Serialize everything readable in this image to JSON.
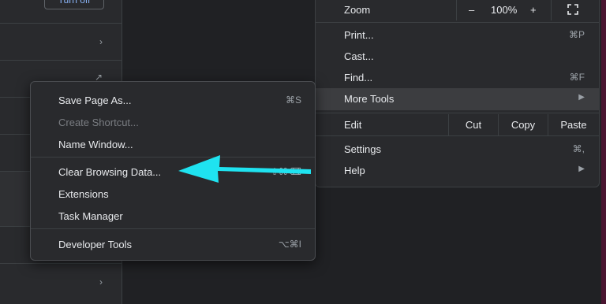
{
  "background": {
    "turn_off_label": "Turn off"
  },
  "main_menu": {
    "zoom": {
      "label": "Zoom",
      "minus": "–",
      "value": "100%",
      "plus": "+",
      "fullscreen_icon": "fullscreen-icon"
    },
    "print": {
      "label": "Print...",
      "shortcut": "⌘P"
    },
    "cast": {
      "label": "Cast..."
    },
    "find": {
      "label": "Find...",
      "shortcut": "⌘F"
    },
    "more_tools": {
      "label": "More Tools"
    },
    "edit": {
      "label": "Edit",
      "cut": "Cut",
      "copy": "Copy",
      "paste": "Paste"
    },
    "settings": {
      "label": "Settings",
      "shortcut": "⌘,"
    },
    "help": {
      "label": "Help"
    }
  },
  "more_tools_menu": {
    "save_page": {
      "label": "Save Page As...",
      "shortcut": "⌘S"
    },
    "create_shortcut": {
      "label": "Create Shortcut..."
    },
    "name_window": {
      "label": "Name Window..."
    },
    "clear_browsing": {
      "label": "Clear Browsing Data...",
      "shortcut": "⇧⌘⌫"
    },
    "extensions": {
      "label": "Extensions"
    },
    "task_manager": {
      "label": "Task Manager"
    },
    "developer_tools": {
      "label": "Developer Tools",
      "shortcut": "⌥⌘I"
    }
  },
  "colors": {
    "annotation_arrow": "#1fe3f0",
    "menu_bg": "#292a2d",
    "highlight": "#3c3d40"
  }
}
